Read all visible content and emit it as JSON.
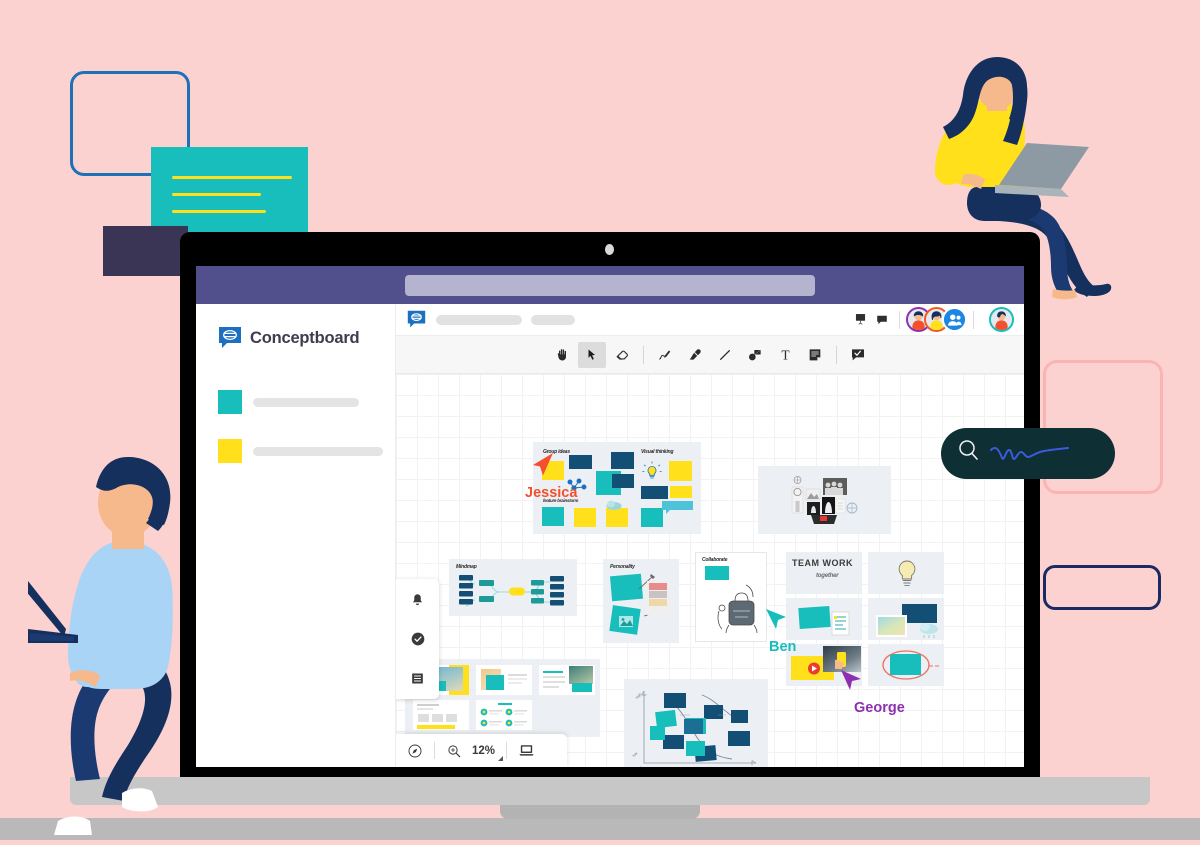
{
  "page": {
    "background_color": "#fcd2d1",
    "title": "Conceptboard collaborative whiteboard hero illustration"
  },
  "browser": {
    "url_bar_placeholder": ""
  },
  "sidebar": {
    "brand": {
      "name": "Conceptboard",
      "logo_icon": "conceptboard-speech-bubble-logo",
      "logo_color": "#1b86e3"
    },
    "items": [
      {
        "label": "",
        "swatch_color": "#17bebb",
        "swatch_name": "teal-swatch"
      },
      {
        "label": "",
        "swatch_color": "#ffe01b",
        "swatch_name": "yellow-swatch"
      }
    ]
  },
  "app_header": {
    "logo_icon": "conceptboard-logo-icon",
    "board_title": "",
    "board_subtitle": "",
    "icons": [
      {
        "name": "presentation-icon",
        "glyph": "present"
      },
      {
        "name": "chat-bubble-icon",
        "glyph": "chat"
      }
    ],
    "collaborators": [
      {
        "name": "avatar-collaborator-1",
        "ring_color": "#8e2fb0"
      },
      {
        "name": "avatar-collaborator-2",
        "ring_color": "#f15a24"
      },
      {
        "name": "avatar-invite-people",
        "ring_color": "#1b86e3"
      }
    ],
    "self_avatar": {
      "name": "avatar-self",
      "ring_color": "#17bebb"
    }
  },
  "toolbar": {
    "active_tool": "select",
    "tools": [
      {
        "name": "hand-tool",
        "label": "Hand",
        "glyph": "hand"
      },
      {
        "name": "select-tool",
        "label": "Select",
        "glyph": "cursor",
        "active": true
      },
      {
        "name": "eraser-tool",
        "label": "Eraser",
        "glyph": "eraser"
      },
      {
        "name": "pen-tool",
        "label": "Pen",
        "glyph": "pen"
      },
      {
        "name": "marker-tool",
        "label": "Marker",
        "glyph": "marker"
      },
      {
        "name": "line-tool",
        "label": "Line",
        "glyph": "line"
      },
      {
        "name": "shape-tool",
        "label": "Shape",
        "glyph": "shapes"
      },
      {
        "name": "text-tool",
        "label": "Text",
        "glyph": "T"
      },
      {
        "name": "sticky-note-tool",
        "label": "Sticky note",
        "glyph": "note"
      },
      {
        "name": "comment-tool",
        "label": "Comment",
        "glyph": "comment"
      }
    ]
  },
  "left_panel": {
    "items": [
      {
        "name": "notifications-bell-icon",
        "label": "Notifications"
      },
      {
        "name": "tasks-check-icon",
        "label": "Tasks"
      },
      {
        "name": "board-list-icon",
        "label": "Board overview"
      }
    ]
  },
  "zoom_bar": {
    "navigator_icon": "compass-navigator-icon",
    "zoom_in_icon": "magnifier-plus-icon",
    "zoom_level": "12%",
    "presentation_icon": "laptop-presentation-icon"
  },
  "cursors": [
    {
      "name": "Jessica",
      "color": "#f4502d"
    },
    {
      "name": "Ben",
      "color": "#17bebb"
    },
    {
      "name": "George",
      "color": "#8e2fb0"
    }
  ],
  "search_overlay": {
    "icon": "search-magnifier-icon",
    "value": "",
    "placeholder": "",
    "background_color": "#0e2f33",
    "squiggle_color": "#3b5bdb"
  },
  "canvas": {
    "boards": [
      {
        "name": "board-ideation",
        "headings": [
          "Group ideas",
          "Visual thinking",
          "feature brainstorm"
        ]
      },
      {
        "name": "board-moodboard",
        "headings": []
      },
      {
        "name": "board-mindmap",
        "headings": [
          "Mindmap"
        ]
      },
      {
        "name": "board-personas",
        "headings": [
          "Personality"
        ]
      },
      {
        "name": "board-collaborate",
        "headings": [
          "Collaborate"
        ]
      },
      {
        "name": "board-teamwork",
        "headings": [
          "TEAM WORK",
          "together"
        ]
      },
      {
        "name": "board-slides",
        "headings": []
      },
      {
        "name": "board-matrix-chart",
        "headings": []
      }
    ],
    "sticky_colors": [
      "#17bebb",
      "#134f75",
      "#ffe01b"
    ]
  },
  "decorations": [
    {
      "name": "outline-square-blue",
      "color": "#1d71b8"
    },
    {
      "name": "teal-card-with-lines",
      "color": "#17bebb",
      "line_color": "#ffe01b"
    },
    {
      "name": "dark-purple-square",
      "color": "#3b3555"
    },
    {
      "name": "outline-square-pink-1",
      "color": "#f5a9a9"
    },
    {
      "name": "outline-square-pink-2",
      "color": "#f5a9a9"
    },
    {
      "name": "outline-square-navy",
      "color": "#1b2a63"
    }
  ],
  "characters": [
    {
      "name": "woman-with-laptop-illustration",
      "sweater_color": "#ffe01b",
      "hair_color": "#16305e"
    },
    {
      "name": "man-walking-with-laptop-illustration",
      "shirt_color": "#a9d4f5",
      "pants_color": "#16305e"
    }
  ]
}
